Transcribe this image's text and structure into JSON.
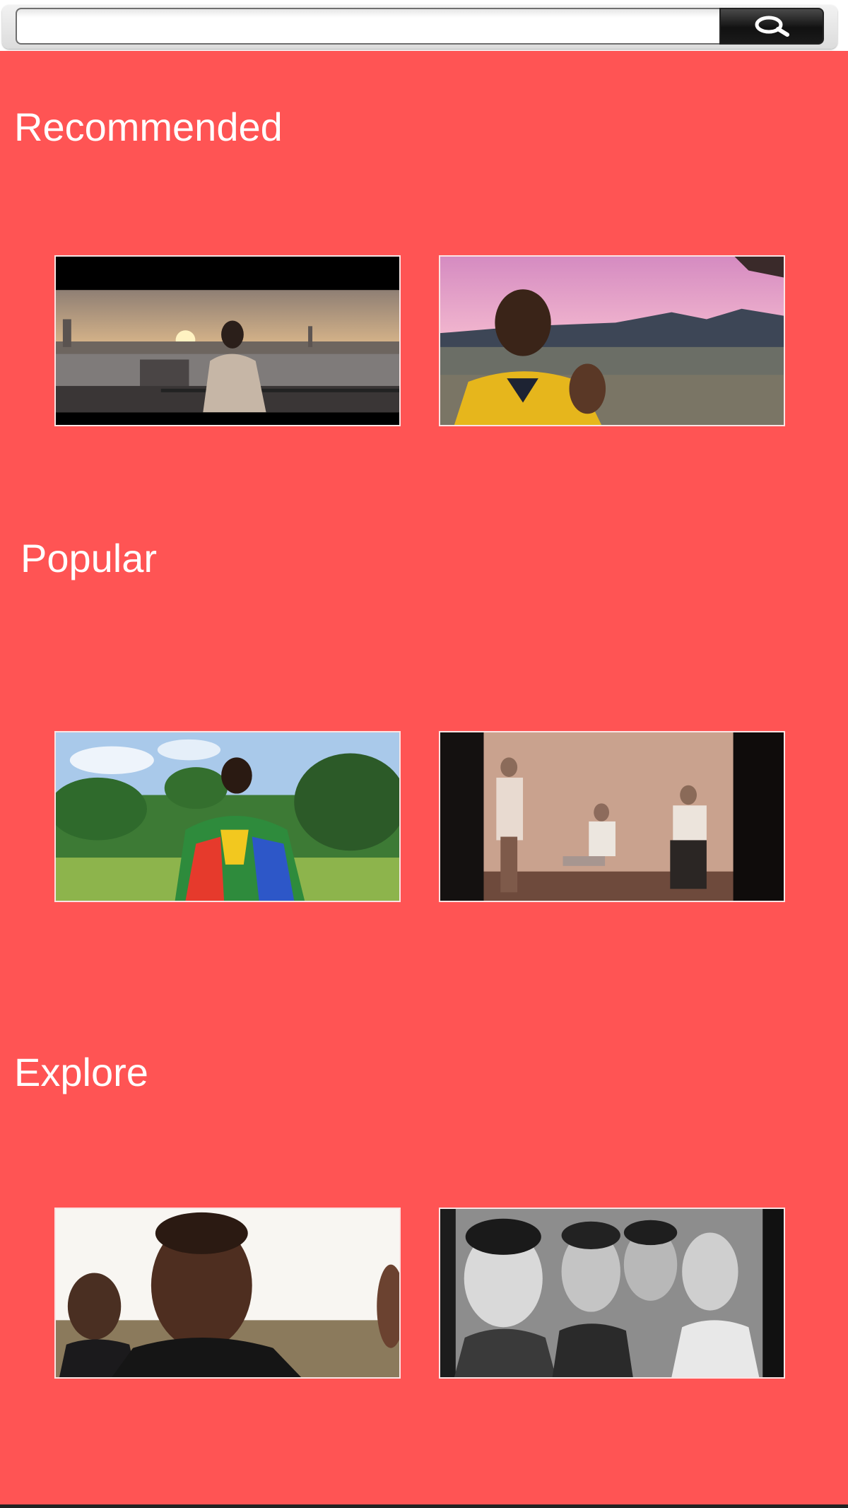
{
  "search": {
    "value": "",
    "placeholder": ""
  },
  "sections": [
    {
      "title": "Recommended",
      "videos": [
        {
          "icon": "video-thumbnail-skyline-sunset"
        },
        {
          "icon": "video-thumbnail-desert-sunset"
        }
      ]
    },
    {
      "title": "Popular",
      "videos": [
        {
          "icon": "video-thumbnail-tropical-field"
        },
        {
          "icon": "video-thumbnail-room-group"
        }
      ]
    },
    {
      "title": "Explore",
      "videos": [
        {
          "icon": "video-thumbnail-two-men-portrait"
        },
        {
          "icon": "video-thumbnail-bw-band-photo"
        }
      ]
    }
  ],
  "colors": {
    "background": "#ff5454",
    "title_text": "#ffffff",
    "search_button": "#111111"
  },
  "icons": {
    "search_button": "search-icon"
  }
}
